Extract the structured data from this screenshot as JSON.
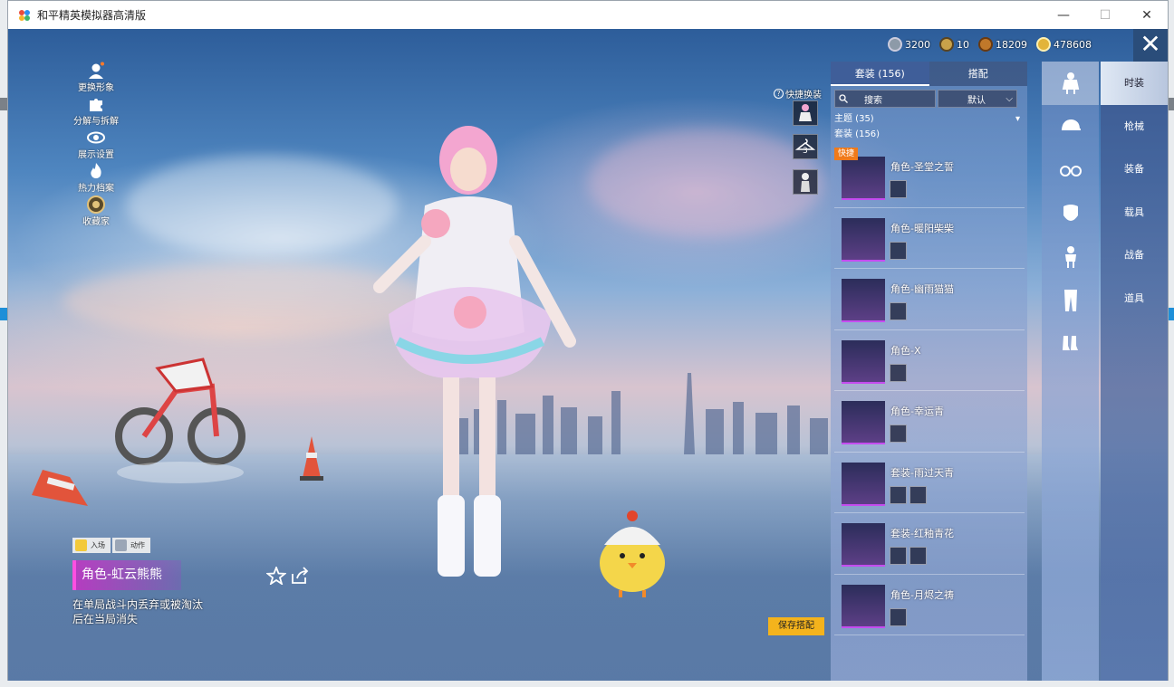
{
  "window": {
    "title": "和平精英模拟器高清版",
    "minimize": "—",
    "maximize": "☐",
    "close": "✕"
  },
  "resources": [
    {
      "icon": "silver-coin-icon",
      "value": "3200",
      "color": "#8d9aa8"
    },
    {
      "icon": "a-token-icon",
      "value": "10",
      "color": "#c9a24a"
    },
    {
      "icon": "bronze-coin-icon",
      "value": "18209",
      "color": "#c0782a"
    },
    {
      "icon": "gold-coin-icon",
      "value": "478608",
      "color": "#e2b43a"
    }
  ],
  "left_menu": [
    {
      "label": "更换形象",
      "icon": "avatar-icon"
    },
    {
      "label": "分解与拆解",
      "icon": "puzzle-icon"
    },
    {
      "label": "展示设置",
      "icon": "eye-icon"
    },
    {
      "label": "热力档案",
      "icon": "flame-icon"
    },
    {
      "label": "收藏家",
      "icon": "collector-badge-icon"
    }
  ],
  "emotes": [
    {
      "label": "入场",
      "icon": "smile-emote-icon"
    },
    {
      "label": "动作",
      "icon": "pose-emote-icon"
    }
  ],
  "selected_item": {
    "name": "角色-虹云熊熊",
    "description": "在单局战斗内丢弃或被淘汰后在当局消失"
  },
  "quick_swap": {
    "label": "快捷换装",
    "help": "?",
    "slot_number": "3"
  },
  "panel": {
    "tabs": [
      "套装 (156)",
      "搭配"
    ],
    "search_placeholder": "搜索",
    "sort_label": "默认",
    "filter_theme": "主题 (35)",
    "filter_suits": "套装 (156)",
    "quick_badge": "快捷",
    "outfits": [
      {
        "name": "角色-圣堂之誓"
      },
      {
        "name": "角色-暖阳柴柴"
      },
      {
        "name": "角色-幽雨猫猫"
      },
      {
        "name": "角色-X"
      },
      {
        "name": "角色-幸运青"
      },
      {
        "name": "套装-雨过天青"
      },
      {
        "name": "套装-红釉青花"
      },
      {
        "name": "角色-月烬之祷"
      }
    ],
    "save_button": "保存搭配"
  },
  "category_rail": [
    "outfit-figure-icon",
    "cap-icon",
    "glasses-icon",
    "mask-icon",
    "figure-icon",
    "pants-icon",
    "socks-icon"
  ],
  "label_rail": [
    "时装",
    "枪械",
    "装备",
    "载具",
    "战备",
    "道具"
  ],
  "colors": {
    "accent": "#f4b31c",
    "quick_badge": "#f07a1a",
    "highlight": "#ff4fe1"
  }
}
